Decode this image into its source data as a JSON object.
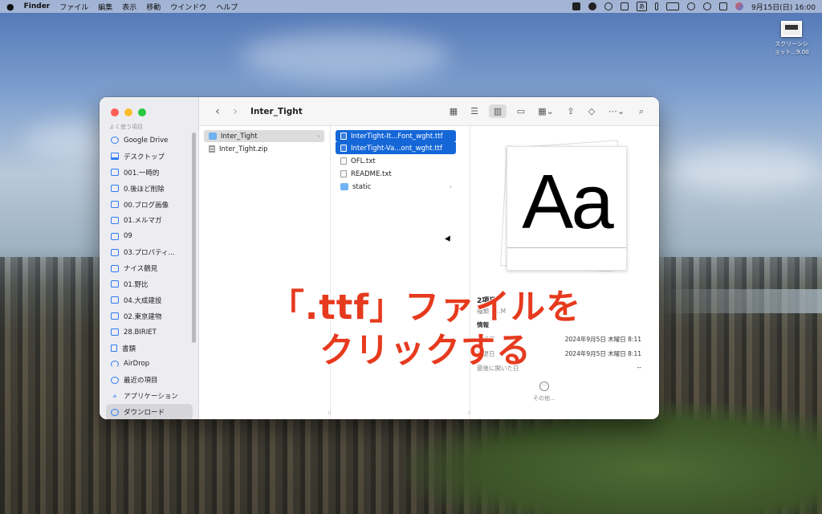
{
  "menubar": {
    "apple": "",
    "app_name": "Finder",
    "items": [
      "ファイル",
      "編集",
      "表示",
      "移動",
      "ウインドウ",
      "ヘルプ"
    ],
    "input_source": "あ",
    "clock": "9月15日(日) 16:00"
  },
  "desktop": {
    "file_label": "スクリーンシ\nョット...9.00"
  },
  "finder": {
    "title": "Inter_Tight",
    "sidebar_section": "よく使う項目",
    "sidebar": [
      {
        "label": "Google Drive",
        "icon": "gdrive-icon"
      },
      {
        "label": "デスクトップ",
        "icon": "desktop-icon"
      },
      {
        "label": "001.一時的",
        "icon": "folder-icon"
      },
      {
        "label": "0.後ほど削除",
        "icon": "folder-icon"
      },
      {
        "label": "00.ブログ画像",
        "icon": "folder-icon"
      },
      {
        "label": "01.メルマガ",
        "icon": "folder-icon"
      },
      {
        "label": "09",
        "icon": "folder-icon"
      },
      {
        "label": "03.プロパティ...",
        "icon": "folder-icon"
      },
      {
        "label": "ナイス鶴見",
        "icon": "folder-icon"
      },
      {
        "label": "01.野比",
        "icon": "folder-icon"
      },
      {
        "label": "04.大成建設",
        "icon": "folder-icon"
      },
      {
        "label": "02.東京建物",
        "icon": "folder-icon"
      },
      {
        "label": "28.BIRIET",
        "icon": "folder-icon"
      },
      {
        "label": "書類",
        "icon": "document-icon"
      },
      {
        "label": "AirDrop",
        "icon": "airdrop-icon"
      },
      {
        "label": "最近の項目",
        "icon": "clock-icon"
      },
      {
        "label": "アプリケーション",
        "icon": "applications-icon"
      },
      {
        "label": "ダウンロード",
        "icon": "download-icon"
      }
    ],
    "column1": [
      {
        "label": "Inter_Tight",
        "type": "folder",
        "selected": "gray"
      },
      {
        "label": "Inter_Tight.zip",
        "type": "zip",
        "selected": "none"
      }
    ],
    "column2": [
      {
        "label": "InterTight-It...Font_wght.ttf",
        "type": "font",
        "selected": "blue"
      },
      {
        "label": "InterTight-Va...ont_wght.ttf",
        "type": "font",
        "selected": "blue"
      },
      {
        "label": "OFL.txt",
        "type": "text",
        "selected": "none"
      },
      {
        "label": "README.txt",
        "type": "text",
        "selected": "none"
      },
      {
        "label": "static",
        "type": "folder",
        "selected": "none"
      }
    ],
    "preview": {
      "glyph": "Aa",
      "title": "2項目",
      "subtitle": "種類 - 1.M",
      "info_header": "情報",
      "rows": [
        {
          "key": "作成日",
          "value": "2024年9月5日 木曜日 8:11"
        },
        {
          "key": "変更日",
          "value": "2024年9月5日 木曜日 8:11"
        },
        {
          "key": "最後に開いた日",
          "value": "--"
        }
      ],
      "more_label": "その他..."
    }
  },
  "annotation": {
    "line1": "「.ttf」ファイルを",
    "line2": "クリックする"
  },
  "colors": {
    "accent": "#1567d8",
    "annotation": "#e63a1e"
  }
}
